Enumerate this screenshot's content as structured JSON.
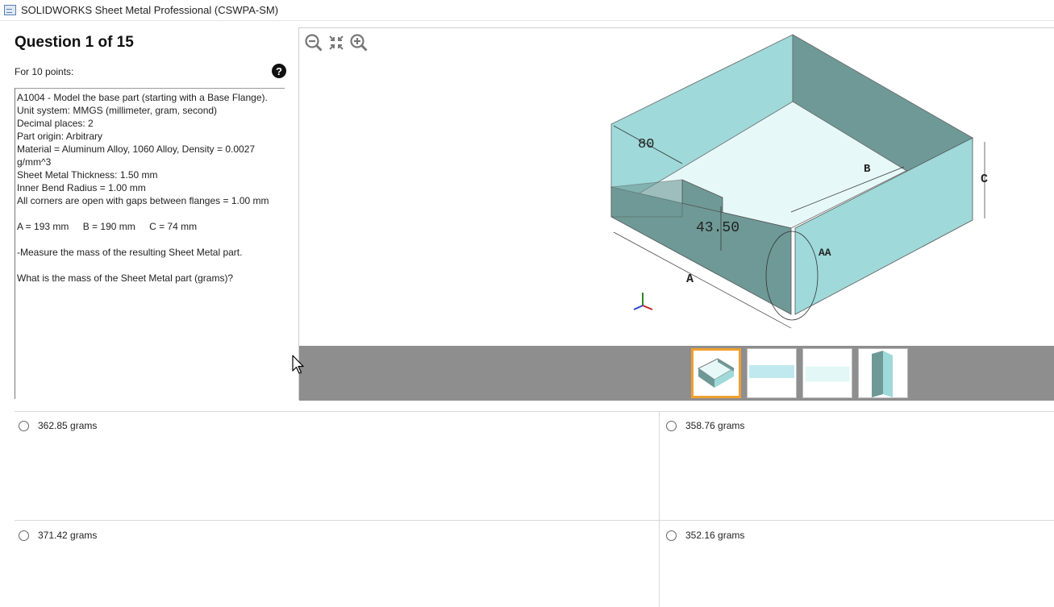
{
  "window": {
    "title": "SOLIDWORKS Sheet Metal Professional (CSWPA-SM)"
  },
  "question": {
    "heading": "Question 1 of 15",
    "points": "For 10 points:",
    "lines": [
      "A1004 - Model the base part (starting with a Base Flange).",
      "Unit system: MMGS (millimeter, gram, second)",
      "Decimal places: 2",
      "Part origin: Arbitrary",
      "Material = Aluminum Alloy, 1060 Alloy, Density = 0.0027",
      "g/mm^3",
      "Sheet Metal Thickness: 1.50 mm",
      "Inner Bend Radius = 1.00 mm",
      "All corners are open with gaps between flanges = 1.00 mm"
    ],
    "dims": [
      "A = 193 mm",
      "B = 190 mm",
      "C = 74 mm"
    ],
    "task": "-Measure the mass of the resulting Sheet Metal part.",
    "prompt": "What is the mass of the Sheet Metal part (grams)?"
  },
  "viewer": {
    "icons": [
      "zoom-out-icon",
      "fit-screen-icon",
      "zoom-in-icon"
    ],
    "labels": {
      "d80": "80",
      "d4350": "43.50",
      "b": "B",
      "c": "C",
      "a": "A",
      "aa": "AA"
    },
    "thumbnail_count": 4,
    "active_thumbnail": 1
  },
  "answers": [
    {
      "label": "362.85 grams",
      "selected": false
    },
    {
      "label": "358.76 grams",
      "selected": false
    },
    {
      "label": "371.42 grams",
      "selected": false
    },
    {
      "label": "352.16 grams",
      "selected": false
    }
  ],
  "colors": {
    "accent": "#f0a030",
    "part_face": "#9fd9d9",
    "part_dark": "#6e9996",
    "part_floor": "#e4f7f7",
    "strip": "#8e8e8e"
  }
}
